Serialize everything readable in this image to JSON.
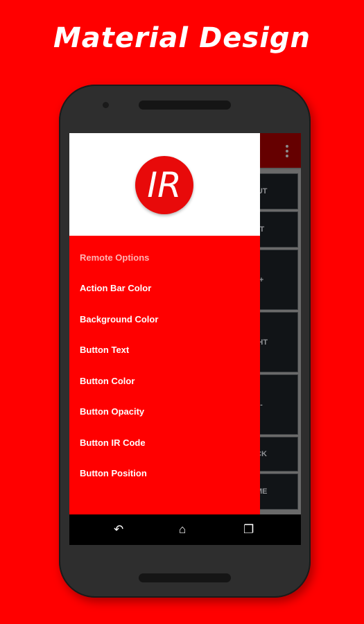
{
  "headline": "Material Design",
  "logo_text": "IR",
  "drawer": {
    "section": "Remote Options",
    "items": [
      "Action Bar Color",
      "Background Color",
      "Button Text",
      "Button Color",
      "Button Opacity",
      "Button IR Code",
      "Button Position"
    ]
  },
  "remote_buttons": [
    "INPUT",
    "EXIT",
    "CH+",
    "RIGHT",
    "CH-",
    "BACK",
    "HOME"
  ],
  "colors": {
    "background": "#ff0000",
    "action_bar": "#650000",
    "drawer": "#ff0000"
  },
  "icons": {
    "overflow": "more-vert-icon",
    "back": "back-icon",
    "home": "home-icon",
    "recents": "recents-icon"
  }
}
